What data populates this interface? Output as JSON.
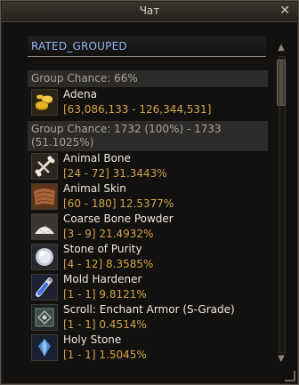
{
  "window": {
    "title": "Чат",
    "close_glyph": "✕"
  },
  "tab": {
    "label": "RATED_GROUPED"
  },
  "groups": [
    {
      "header": "Group Chance: 66%",
      "items": [
        {
          "name": "Adena",
          "drop": "[63,086,133 - 126,344,531]",
          "icon": "adena-coins-icon"
        }
      ]
    },
    {
      "header": "Group Chance: 1732 (100%) - 1733 (51.1025%)",
      "items": [
        {
          "name": "Animal Bone",
          "drop": "[24 - 72] 31.3443%",
          "icon": "bone-icon"
        },
        {
          "name": "Animal Skin",
          "drop": "[60 - 180] 12.5377%",
          "icon": "skin-icon"
        },
        {
          "name": "Coarse Bone Powder",
          "drop": "[3 - 9] 21.4932%",
          "icon": "bone-powder-icon"
        },
        {
          "name": "Stone of Purity",
          "drop": "[4 - 12] 8.3585%",
          "icon": "stone-of-purity-icon"
        },
        {
          "name": "Mold Hardener",
          "drop": "[1 - 1] 9.8121%",
          "icon": "mold-hardener-icon"
        },
        {
          "name": "Scroll: Enchant Armor (S-Grade)",
          "drop": "[1 - 1] 0.4514%",
          "icon": "scroll-icon"
        },
        {
          "name": "Holy Stone",
          "drop": "[1 - 1] 1.5045%",
          "icon": "holy-stone-icon"
        }
      ]
    }
  ],
  "scrollbar": {
    "up_glyph": "▲",
    "down_glyph": "▼"
  }
}
